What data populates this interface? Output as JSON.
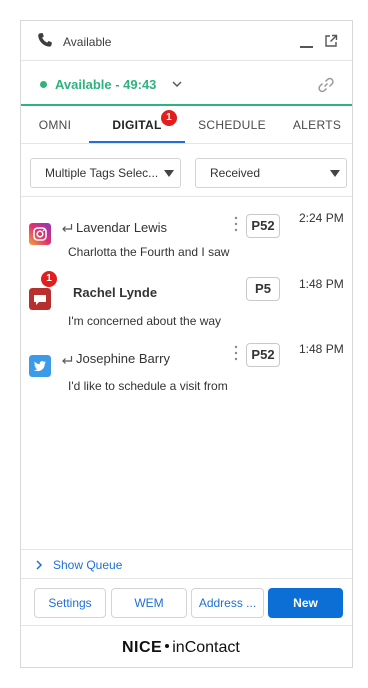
{
  "header": {
    "title": "Available"
  },
  "status": {
    "label": "Available - 49:43",
    "color": "#2fb37c"
  },
  "tabs": [
    {
      "label": "OMNI"
    },
    {
      "label": "DIGITAL",
      "badge": "1"
    },
    {
      "label": "SCHEDULE"
    },
    {
      "label": "ALERTS"
    }
  ],
  "filters": {
    "tags": "Multiple Tags Selec...",
    "state": "Received"
  },
  "conversations": [
    {
      "channel": "instagram-icon",
      "name": "Lavendar Lewis",
      "priority": "P52",
      "time": "2:24 PM",
      "preview": "Charlotta the Fourth and I saw"
    },
    {
      "channel": "chat-icon",
      "name": "Rachel Lynde",
      "priority": "P5",
      "time": "1:48 PM",
      "preview": "I'm concerned about the way",
      "badge": "1"
    },
    {
      "channel": "twitter-icon",
      "name": "Josephine Barry",
      "priority": "P52",
      "time": "1:48 PM",
      "preview": "I'd like to schedule a visit from"
    }
  ],
  "queue": {
    "label": "Show Queue"
  },
  "buttons": {
    "settings": "Settings",
    "wem": "WEM",
    "address": "Address ...",
    "new": "New"
  },
  "footer": {
    "brand_a": "NICE",
    "brand_b": "inContact"
  },
  "colors": {
    "accent": "#1e6fd9",
    "available": "#2fb37c",
    "badge": "#e0201f",
    "primary_button": "#0b6fd6"
  }
}
